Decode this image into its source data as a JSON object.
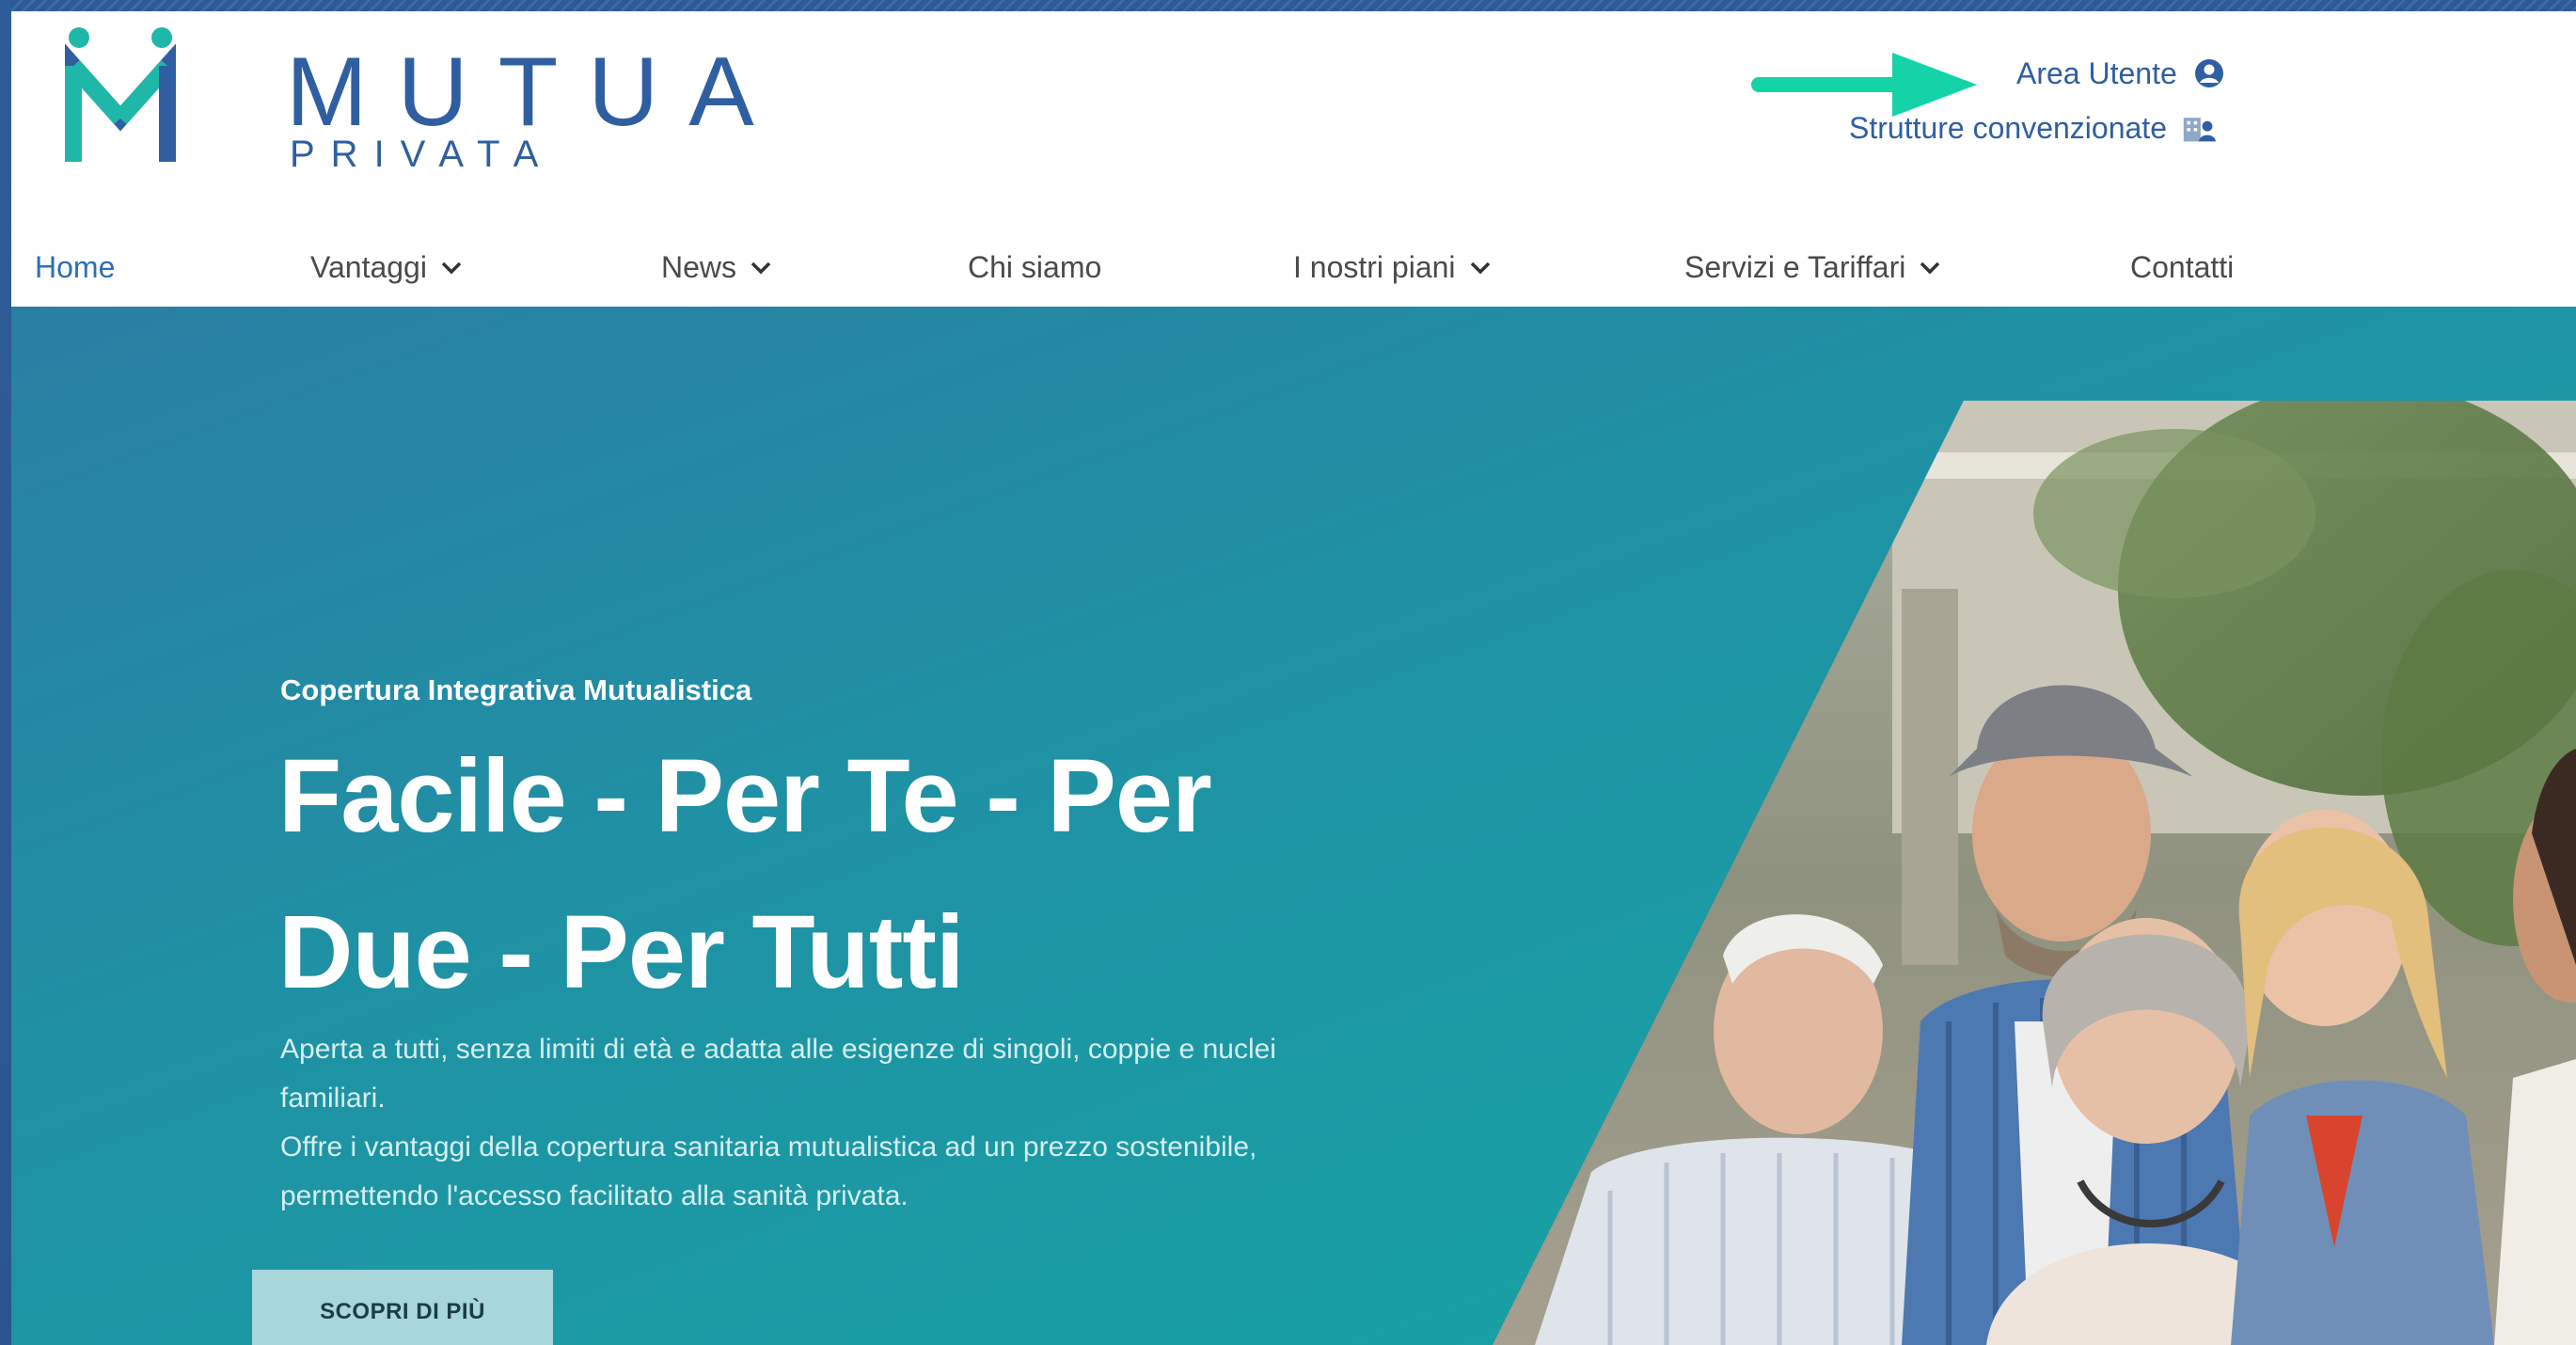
{
  "brand": {
    "name": "MUTUA",
    "sub": "PRIVATA",
    "colors": {
      "primary": "#2f5fa0",
      "accent": "#1fb8a8",
      "arrow": "#14d3a7"
    }
  },
  "utility_links": {
    "area_utente": {
      "label": "Area Utente",
      "icon": "user-circle-icon"
    },
    "strutture": {
      "label": "Strutture convenzionate",
      "icon": "building-user-icon"
    }
  },
  "nav": {
    "items": [
      {
        "label": "Home",
        "active": true,
        "dropdown": false
      },
      {
        "label": "Vantaggi",
        "dropdown": true
      },
      {
        "label": "News",
        "dropdown": true
      },
      {
        "label": "Chi siamo",
        "dropdown": false
      },
      {
        "label": "I nostri piani",
        "dropdown": true
      },
      {
        "label": "Servizi e Tariffari",
        "dropdown": true
      },
      {
        "label": "Contatti",
        "dropdown": false
      }
    ]
  },
  "hero": {
    "eyebrow": "Copertura Integrativa Mutualistica",
    "title_line1": "Facile - Per Te - Per",
    "title_line2": "Due - Per Tutti",
    "paragraph1": "Aperta a tutti, senza limiti di età e adatta alle esigenze di singoli, coppie e nuclei familiari.",
    "paragraph2": "Offre i vantaggi della copertura sanitaria mutualistica ad un prezzo sostenibile, permettendo l'accesso facilitato alla sanità privata.",
    "cta_label": "SCOPRI DI PIÙ"
  }
}
